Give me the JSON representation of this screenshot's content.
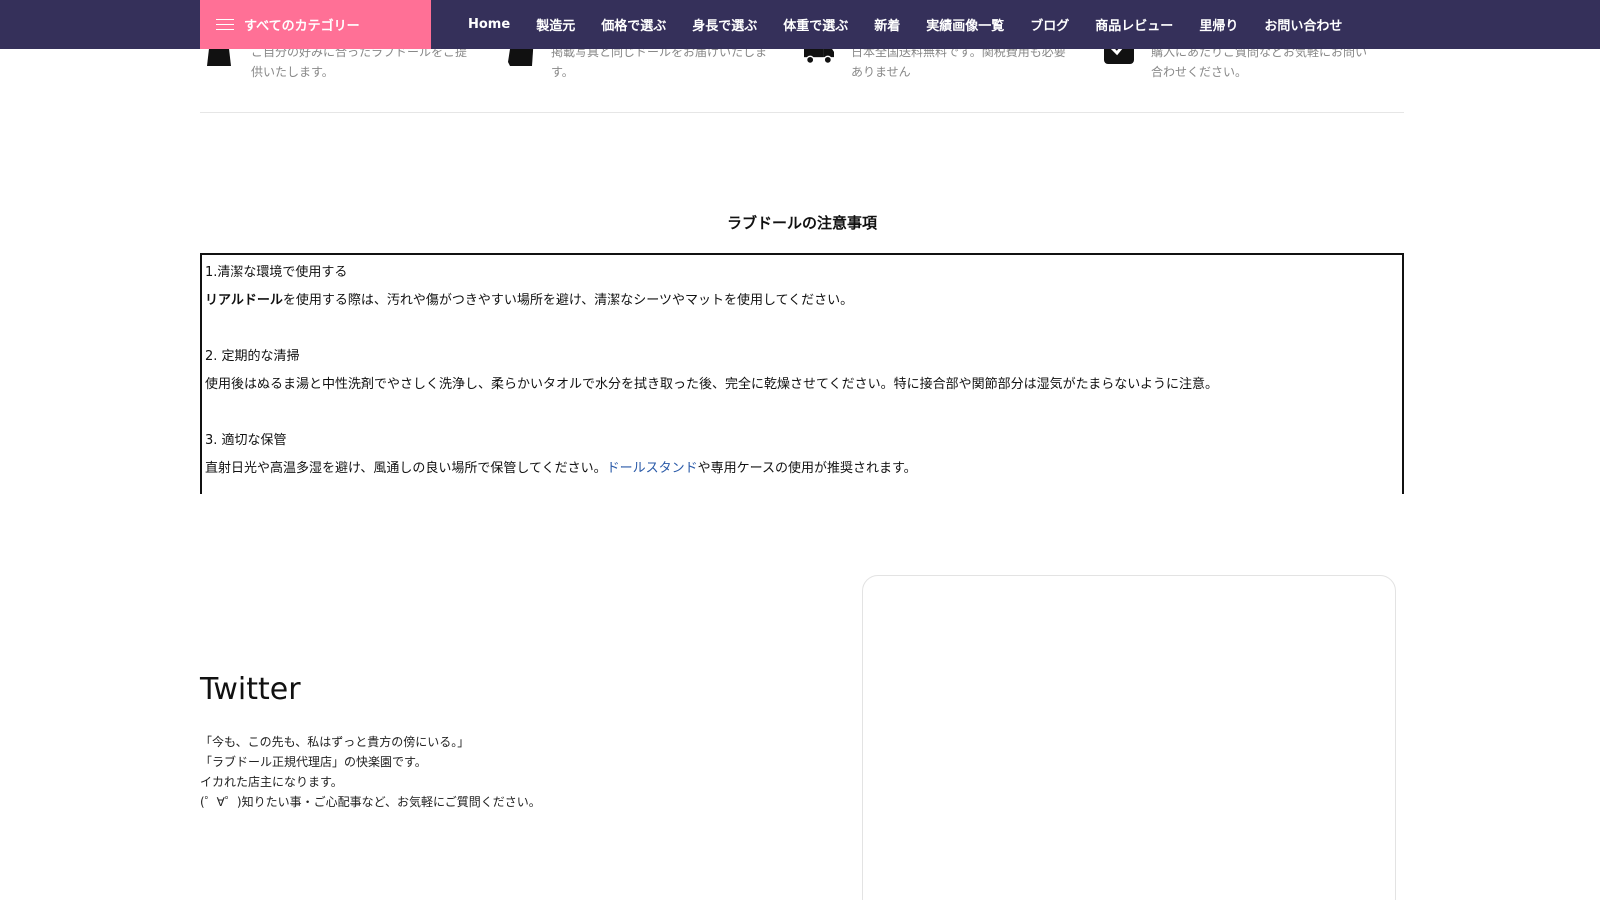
{
  "nav": {
    "category_button": "すべてのカテゴリー",
    "items": [
      "Home",
      "製造元",
      "価格で選ぶ",
      "身長で選ぶ",
      "体重で選ぶ",
      "新着",
      "実績画像一覧",
      "ブログ",
      "商品レビュー",
      "里帰り",
      "お問い合わせ"
    ]
  },
  "features": [
    {
      "icon": "bag-icon",
      "line1": "ご自分の好みに合ったラブドールをご提",
      "line2": "供いたします。"
    },
    {
      "icon": "photo-icon",
      "line1": "掲載写真と同じドールをお届けいたしま",
      "line2": "す。"
    },
    {
      "icon": "truck-icon",
      "line1": "日本全国送料無料です。関税費用も必要",
      "line2": "ありません"
    },
    {
      "icon": "check-icon",
      "line1": "購入にあたりご質問などお気軽にお問い",
      "line2": "合わせください。"
    }
  ],
  "notes": {
    "title": "ラブドールの注意事項",
    "items": [
      {
        "heading": "1.清潔な環境で使用する",
        "bold_prefix": "リアルドール",
        "body": "を使用する際は、汚れや傷がつきやすい場所を避け、清潔なシーツやマットを使用してください。"
      },
      {
        "heading": "2. 定期的な清掃",
        "body": "使用後はぬるま湯と中性洗剤でやさしく洗浄し、柔らかいタオルで水分を拭き取った後、完全に乾燥させてください。特に接合部や関節部分は湿気がたまらないように注意。"
      },
      {
        "heading": "3. 適切な保管",
        "body_before": "直射日光や高温多湿を避け、風通しの良い場所で保管してください。",
        "link": "ドールスタンド",
        "body_after": "や専用ケースの使用が推奨されます。"
      }
    ]
  },
  "twitter": {
    "title": "Twitter",
    "lines": [
      "「今も、この先も、私はずっと貴方の傍にいる。」",
      " 「ラブドール正規代理店」の快楽園です。",
      " イカれた店主になります。",
      "(゜∀゜)知りたい事・ご心配事など、お気軽にご質問ください。"
    ]
  }
}
